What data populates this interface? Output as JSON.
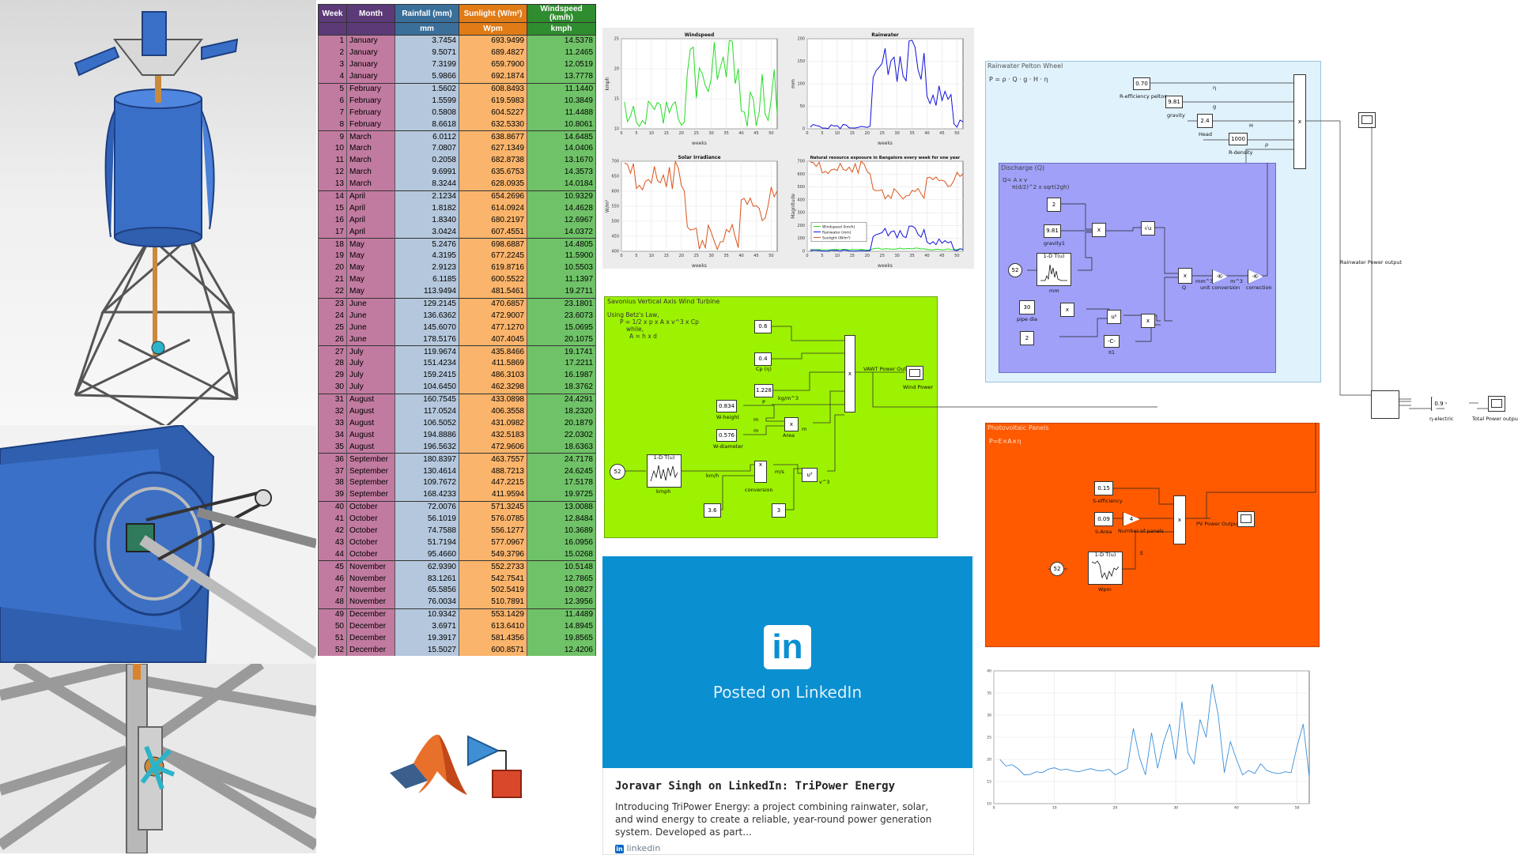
{
  "table": {
    "headers": [
      "Week",
      "Month",
      "Rainfall (mm)",
      "Sunlight (W/m²)",
      "Windspeed (km/h)"
    ],
    "units": [
      "",
      "",
      "mm",
      "Wpm",
      "kmph"
    ],
    "header_colors": [
      "#5c3a78",
      "#5c3a78",
      "#3a6f9a",
      "#e07b16",
      "#2f8c2f"
    ],
    "rows": [
      [
        "1",
        "January",
        "3.7454",
        "693.9499",
        "14.5378"
      ],
      [
        "2",
        "January",
        "9.5071",
        "689.4827",
        "11.2465"
      ],
      [
        "3",
        "January",
        "7.3199",
        "659.7900",
        "12.0519"
      ],
      [
        "4",
        "January",
        "5.9866",
        "692.1874",
        "13.7778"
      ],
      [
        "5",
        "February",
        "1.5602",
        "608.8493",
        "11.1440"
      ],
      [
        "6",
        "February",
        "1.5599",
        "619.5983",
        "10.3849"
      ],
      [
        "7",
        "February",
        "0.5808",
        "604.5227",
        "11.4488"
      ],
      [
        "8",
        "February",
        "8.6618",
        "632.5330",
        "10.8061"
      ],
      [
        "9",
        "March",
        "6.0112",
        "638.8677",
        "14.6485"
      ],
      [
        "10",
        "March",
        "7.0807",
        "627.1349",
        "14.0406"
      ],
      [
        "11",
        "March",
        "0.2058",
        "682.8738",
        "13.1670"
      ],
      [
        "12",
        "March",
        "9.6991",
        "635.6753",
        "14.3573"
      ],
      [
        "13",
        "March",
        "8.3244",
        "628.0935",
        "14.0184"
      ],
      [
        "14",
        "April",
        "2.1234",
        "654.2696",
        "10.9329"
      ],
      [
        "15",
        "April",
        "1.8182",
        "614.0924",
        "14.4628"
      ],
      [
        "16",
        "April",
        "1.8340",
        "680.2197",
        "12.6967"
      ],
      [
        "17",
        "April",
        "3.0424",
        "607.4551",
        "14.0372"
      ],
      [
        "18",
        "May",
        "5.2476",
        "698.6887",
        "14.4805"
      ],
      [
        "19",
        "May",
        "4.3195",
        "677.2245",
        "11.5900"
      ],
      [
        "20",
        "May",
        "2.9123",
        "619.8716",
        "10.5503"
      ],
      [
        "21",
        "May",
        "6.1185",
        "600.5522",
        "11.1397"
      ],
      [
        "22",
        "May",
        "113.9494",
        "481.5461",
        "19.2711"
      ],
      [
        "23",
        "June",
        "129.2145",
        "470.6857",
        "23.1801"
      ],
      [
        "24",
        "June",
        "136.6362",
        "472.9007",
        "23.6073"
      ],
      [
        "25",
        "June",
        "145.6070",
        "477.1270",
        "15.0695"
      ],
      [
        "26",
        "June",
        "178.5176",
        "407.4045",
        "20.1075"
      ],
      [
        "27",
        "July",
        "119.9674",
        "435.8466",
        "19.1741"
      ],
      [
        "28",
        "July",
        "151.4234",
        "411.5869",
        "17.2211"
      ],
      [
        "29",
        "July",
        "159.2415",
        "486.3103",
        "16.1987"
      ],
      [
        "30",
        "July",
        "104.6450",
        "462.3298",
        "18.3762"
      ],
      [
        "31",
        "August",
        "160.7545",
        "433.0898",
        "24.4291"
      ],
      [
        "32",
        "August",
        "117.0524",
        "406.3558",
        "18.2320"
      ],
      [
        "33",
        "August",
        "106.5052",
        "431.0982",
        "20.1879"
      ],
      [
        "34",
        "August",
        "194.8886",
        "432.5183",
        "22.0302"
      ],
      [
        "35",
        "August",
        "196.5632",
        "472.9606",
        "18.6363"
      ],
      [
        "36",
        "September",
        "180.8397",
        "463.7557",
        "24.7178"
      ],
      [
        "37",
        "September",
        "130.4614",
        "488.7213",
        "24.6245"
      ],
      [
        "38",
        "September",
        "109.7672",
        "447.2215",
        "17.5178"
      ],
      [
        "39",
        "September",
        "168.4233",
        "411.9594",
        "19.9725"
      ],
      [
        "40",
        "October",
        "72.0076",
        "571.3245",
        "13.0088"
      ],
      [
        "41",
        "October",
        "56.1019",
        "576.0785",
        "12.8484"
      ],
      [
        "42",
        "October",
        "74.7588",
        "556.1277",
        "10.3689"
      ],
      [
        "43",
        "October",
        "51.7194",
        "577.0967",
        "16.0956"
      ],
      [
        "44",
        "October",
        "95.4660",
        "549.3796",
        "15.0268"
      ],
      [
        "45",
        "November",
        "62.9390",
        "552.2733",
        "10.5148"
      ],
      [
        "46",
        "November",
        "83.1261",
        "542.7541",
        "12.7865"
      ],
      [
        "47",
        "November",
        "65.5856",
        "502.5419",
        "19.0827"
      ],
      [
        "48",
        "November",
        "76.0034",
        "510.7891",
        "12.3956"
      ],
      [
        "49",
        "December",
        "10.9342",
        "553.1429",
        "11.4489"
      ],
      [
        "50",
        "December",
        "3.6971",
        "613.6410",
        "14.8945"
      ],
      [
        "51",
        "December",
        "19.3917",
        "581.4356",
        "19.8565"
      ],
      [
        "52",
        "December",
        "15.5027",
        "600.8571",
        "12.4206"
      ]
    ]
  },
  "chart_data": [
    {
      "type": "line",
      "title": "Windspeed",
      "xlabel": "weeks",
      "ylabel": "kmph",
      "xlim": [
        0,
        52
      ],
      "ylim": [
        10,
        25
      ],
      "xticks": [
        "0",
        "5",
        "10",
        "15",
        "20",
        "25",
        "30",
        "35",
        "40",
        "45",
        "50"
      ],
      "yticks": [
        "10",
        "15",
        "20",
        "25"
      ],
      "series": [
        {
          "color": "#22dd22",
          "values": [
            14.5,
            11.2,
            12.1,
            13.8,
            11.1,
            10.4,
            11.4,
            10.8,
            14.6,
            14.0,
            13.2,
            14.4,
            14.0,
            10.9,
            14.5,
            12.7,
            14.0,
            14.5,
            11.6,
            10.6,
            11.1,
            19.3,
            23.2,
            23.6,
            15.1,
            20.1,
            19.2,
            17.2,
            16.2,
            18.4,
            24.4,
            18.2,
            20.2,
            22.0,
            18.6,
            24.7,
            24.6,
            17.5,
            20.0,
            13.0,
            12.8,
            10.4,
            16.1,
            15.0,
            10.5,
            12.8,
            19.1,
            12.4,
            11.4,
            14.9,
            19.9,
            12.4
          ]
        }
      ]
    },
    {
      "type": "line",
      "title": "Rainwater",
      "xlabel": "weeks",
      "ylabel": "mm",
      "xlim": [
        0,
        52
      ],
      "ylim": [
        0,
        200
      ],
      "xticks": [
        "0",
        "5",
        "10",
        "15",
        "20",
        "25",
        "30",
        "35",
        "40",
        "45",
        "50"
      ],
      "yticks": [
        "0",
        "50",
        "100",
        "150",
        "200"
      ],
      "series": [
        {
          "color": "#1010dd",
          "values": [
            3.7,
            9.5,
            7.3,
            6.0,
            1.6,
            1.6,
            0.6,
            8.7,
            6.0,
            7.1,
            0.2,
            9.7,
            8.3,
            2.1,
            1.8,
            1.8,
            3.0,
            5.2,
            4.3,
            2.9,
            6.1,
            113.9,
            129.2,
            136.6,
            145.6,
            178.5,
            120.0,
            151.4,
            159.2,
            104.6,
            160.8,
            117.1,
            106.5,
            194.9,
            196.6,
            180.8,
            130.5,
            109.8,
            168.4,
            72.0,
            56.1,
            74.8,
            51.7,
            95.5,
            62.9,
            83.1,
            65.6,
            76.0,
            10.9,
            3.7,
            19.4,
            15.5
          ]
        }
      ]
    },
    {
      "type": "line",
      "title": "Solar Irradiance",
      "xlabel": "weeks",
      "ylabel": "W/m²",
      "xlim": [
        0,
        52
      ],
      "ylim": [
        400,
        700
      ],
      "xticks": [
        "0",
        "5",
        "10",
        "15",
        "20",
        "25",
        "30",
        "35",
        "40",
        "45",
        "50"
      ],
      "yticks": [
        "400",
        "450",
        "500",
        "550",
        "600",
        "650",
        "700"
      ],
      "series": [
        {
          "color": "#d9541a",
          "values": [
            693.9,
            689.5,
            659.8,
            692.2,
            608.8,
            619.6,
            604.5,
            632.5,
            638.9,
            627.1,
            682.9,
            635.7,
            628.1,
            654.3,
            614.1,
            680.2,
            607.5,
            698.7,
            677.2,
            619.9,
            600.6,
            481.5,
            470.7,
            472.9,
            477.1,
            407.4,
            435.8,
            411.6,
            486.3,
            462.3,
            433.1,
            406.4,
            431.1,
            432.5,
            473.0,
            463.8,
            488.7,
            447.2,
            412.0,
            571.3,
            576.1,
            556.1,
            577.1,
            549.4,
            552.3,
            542.8,
            502.5,
            510.8,
            553.1,
            613.6,
            581.4,
            600.9
          ]
        }
      ]
    },
    {
      "type": "line",
      "title": "Natural resource exposure in Bangalore every week for one year",
      "xlabel": "weeks",
      "ylabel": "Magnitude",
      "xlim": [
        0,
        52
      ],
      "ylim": [
        0,
        700
      ],
      "xticks": [
        "0",
        "5",
        "10",
        "15",
        "20",
        "25",
        "30",
        "35",
        "40",
        "45",
        "50"
      ],
      "yticks": [
        "0",
        "100",
        "200",
        "300",
        "400",
        "500",
        "600",
        "700"
      ],
      "legend": "bottom-left",
      "series": [
        {
          "name": "Windspeed (km/h)",
          "color": "#22dd22",
          "values": [
            14.5,
            11.2,
            12.1,
            13.8,
            11.1,
            10.4,
            11.4,
            10.8,
            14.6,
            14.0,
            13.2,
            14.4,
            14.0,
            10.9,
            14.5,
            12.7,
            14.0,
            14.5,
            11.6,
            10.6,
            11.1,
            19.3,
            23.2,
            23.6,
            15.1,
            20.1,
            19.2,
            17.2,
            16.2,
            18.4,
            24.4,
            18.2,
            20.2,
            22.0,
            18.6,
            24.7,
            24.6,
            17.5,
            20.0,
            13.0,
            12.8,
            10.4,
            16.1,
            15.0,
            10.5,
            12.8,
            19.1,
            12.4,
            11.4,
            14.9,
            19.9,
            12.4
          ]
        },
        {
          "name": "Rainwater (mm)",
          "color": "#1010dd",
          "values": [
            3.7,
            9.5,
            7.3,
            6.0,
            1.6,
            1.6,
            0.6,
            8.7,
            6.0,
            7.1,
            0.2,
            9.7,
            8.3,
            2.1,
            1.8,
            1.8,
            3.0,
            5.2,
            4.3,
            2.9,
            6.1,
            113.9,
            129.2,
            136.6,
            145.6,
            178.5,
            120.0,
            151.4,
            159.2,
            104.6,
            160.8,
            117.1,
            106.5,
            194.9,
            196.6,
            180.8,
            130.5,
            109.8,
            168.4,
            72.0,
            56.1,
            74.8,
            51.7,
            95.5,
            62.9,
            83.1,
            65.6,
            76.0,
            10.9,
            3.7,
            19.4,
            15.5
          ]
        },
        {
          "name": "Sunlight (W/m²)",
          "color": "#d9541a",
          "values": [
            693.9,
            689.5,
            659.8,
            692.2,
            608.8,
            619.6,
            604.5,
            632.5,
            638.9,
            627.1,
            682.9,
            635.7,
            628.1,
            654.3,
            614.1,
            680.2,
            607.5,
            698.7,
            677.2,
            619.9,
            600.6,
            481.5,
            470.7,
            472.9,
            477.1,
            407.4,
            435.8,
            411.6,
            486.3,
            462.3,
            433.1,
            406.4,
            431.1,
            432.5,
            473.0,
            463.8,
            488.7,
            447.2,
            412.0,
            571.3,
            576.1,
            556.1,
            577.1,
            549.4,
            552.3,
            542.8,
            502.5,
            510.8,
            553.1,
            613.6,
            581.4,
            600.9
          ]
        }
      ]
    },
    {
      "type": "line",
      "title": "",
      "xlim": [
        0,
        52
      ],
      "ylim": [
        10,
        40
      ],
      "xticks": [
        "0",
        "10",
        "20",
        "30",
        "40",
        "50"
      ],
      "yticks": [
        "10",
        "15",
        "20",
        "25",
        "30",
        "35",
        "40"
      ],
      "series": [
        {
          "color": "#3a8fd9",
          "values": [
            20,
            18.5,
            18.8,
            17.9,
            16.5,
            16.6,
            17.2,
            17.0,
            17.8,
            18.1,
            17.6,
            17.8,
            17.4,
            17.2,
            17.6,
            17.9,
            17.5,
            17.4,
            17.8,
            16.5,
            17.2,
            17.9,
            27,
            20.5,
            16.5,
            26,
            18,
            24,
            28,
            20,
            33,
            21.5,
            19,
            29,
            25,
            37,
            30,
            17,
            24,
            20,
            16.5,
            17.5,
            16.8,
            19,
            17.5,
            17,
            16.8,
            17.2,
            17,
            23,
            28,
            16
          ]
        }
      ]
    }
  ],
  "simulink": {
    "wind": {
      "title": "Savonius Vertical Axis Wind Turbine",
      "notes": [
        "Using Betz's Law,",
        "P = 1/2 x p x A x v^3 x Cp",
        "while,",
        "A = h x d"
      ],
      "blocks": {
        "cp": "0.6",
        "cp_label": "Cp (η)",
        "rho": "0.4",
        "density": "1.228",
        "density_unit": "kg/m^3",
        "wheight": "0.834",
        "wheight_label": "W-height",
        "wdiameter": "0.576",
        "wdiameter_label": "W-diameter",
        "area_label": "Area",
        "clock": "52",
        "lookup": "1-D T(u)",
        "lookup_label": "kmph",
        "kmh": "km/h",
        "conversion_label": "conversion",
        "ms": "m/s",
        "cube": "u³",
        "v3": "v^3",
        "c36": "3.6",
        "c3": "3",
        "product": "x",
        "out_label": "VAWT Power Output",
        "scope_label": "Wind Power",
        "p": "P",
        "m1": "m",
        "m2": "m",
        "m3": "m"
      }
    },
    "rain": {
      "title": "Rainwater Pelton Wheel",
      "formula": "P = ρ · Q · g · H · η",
      "blocks": {
        "eff": "0.70",
        "eff_label": "R-efficiency pelton",
        "grav": "9.81",
        "grav_label": "gravity",
        "head": "2.4",
        "head_label": "Head",
        "dens": "1000",
        "dens_label": "R-density",
        "eta": "η",
        "g": "g",
        "h": "H",
        "rho": "ρ",
        "out_label": "Rainwater Power output"
      },
      "discharge": {
        "title": "Discharge (Q)",
        "formula1": "Q= A x v",
        "formula2": "π(d/2)^2 x sqrt(2gh)",
        "c2a": "2",
        "grav2": "9.81",
        "grav2_label": "gravity1",
        "clock": "52",
        "lookup": "1-D T(u)",
        "lookup_label": "mm",
        "pipe": "30",
        "pipe_label": "pipe dia",
        "c2b": "2",
        "pi": "-C-",
        "pi_label": "π1",
        "sqrt": "√u",
        "u2": "u²",
        "q": "Q",
        "mm3": "mm^3",
        "m3": "m^3",
        "k1": "-K-",
        "k1_label": "unit conversion",
        "k2": "-K-",
        "k2_label": "correction"
      }
    },
    "pv": {
      "title": "Photovoltaic Panels",
      "formula": "P=E×A×η",
      "blocks": {
        "seff": "0.15",
        "seff_label": "S-efficiency",
        "sarea": "0.09",
        "sarea_label": "S-Area",
        "gain": "4",
        "gain_label": "Number of panels",
        "clock": "52",
        "lookup": "1-D T(u)",
        "lookup_label": "Wpm",
        "e": "E",
        "out_label": "PV Power Output"
      }
    },
    "total": {
      "eff": "0.9",
      "eff_label": "η-electric",
      "out_label": "Total Power output"
    }
  },
  "linkedin": {
    "logo": "in",
    "banner_text": "Posted on LinkedIn",
    "title": "Joravar Singh on LinkedIn: TriPower Energy",
    "description": "Introducing TriPower Energy: a project combining rainwater, solar, and wind energy to create a reliable, year-round power generation system. Developed as part...",
    "source": "linkedin",
    "accent": "#0a8fd1"
  }
}
